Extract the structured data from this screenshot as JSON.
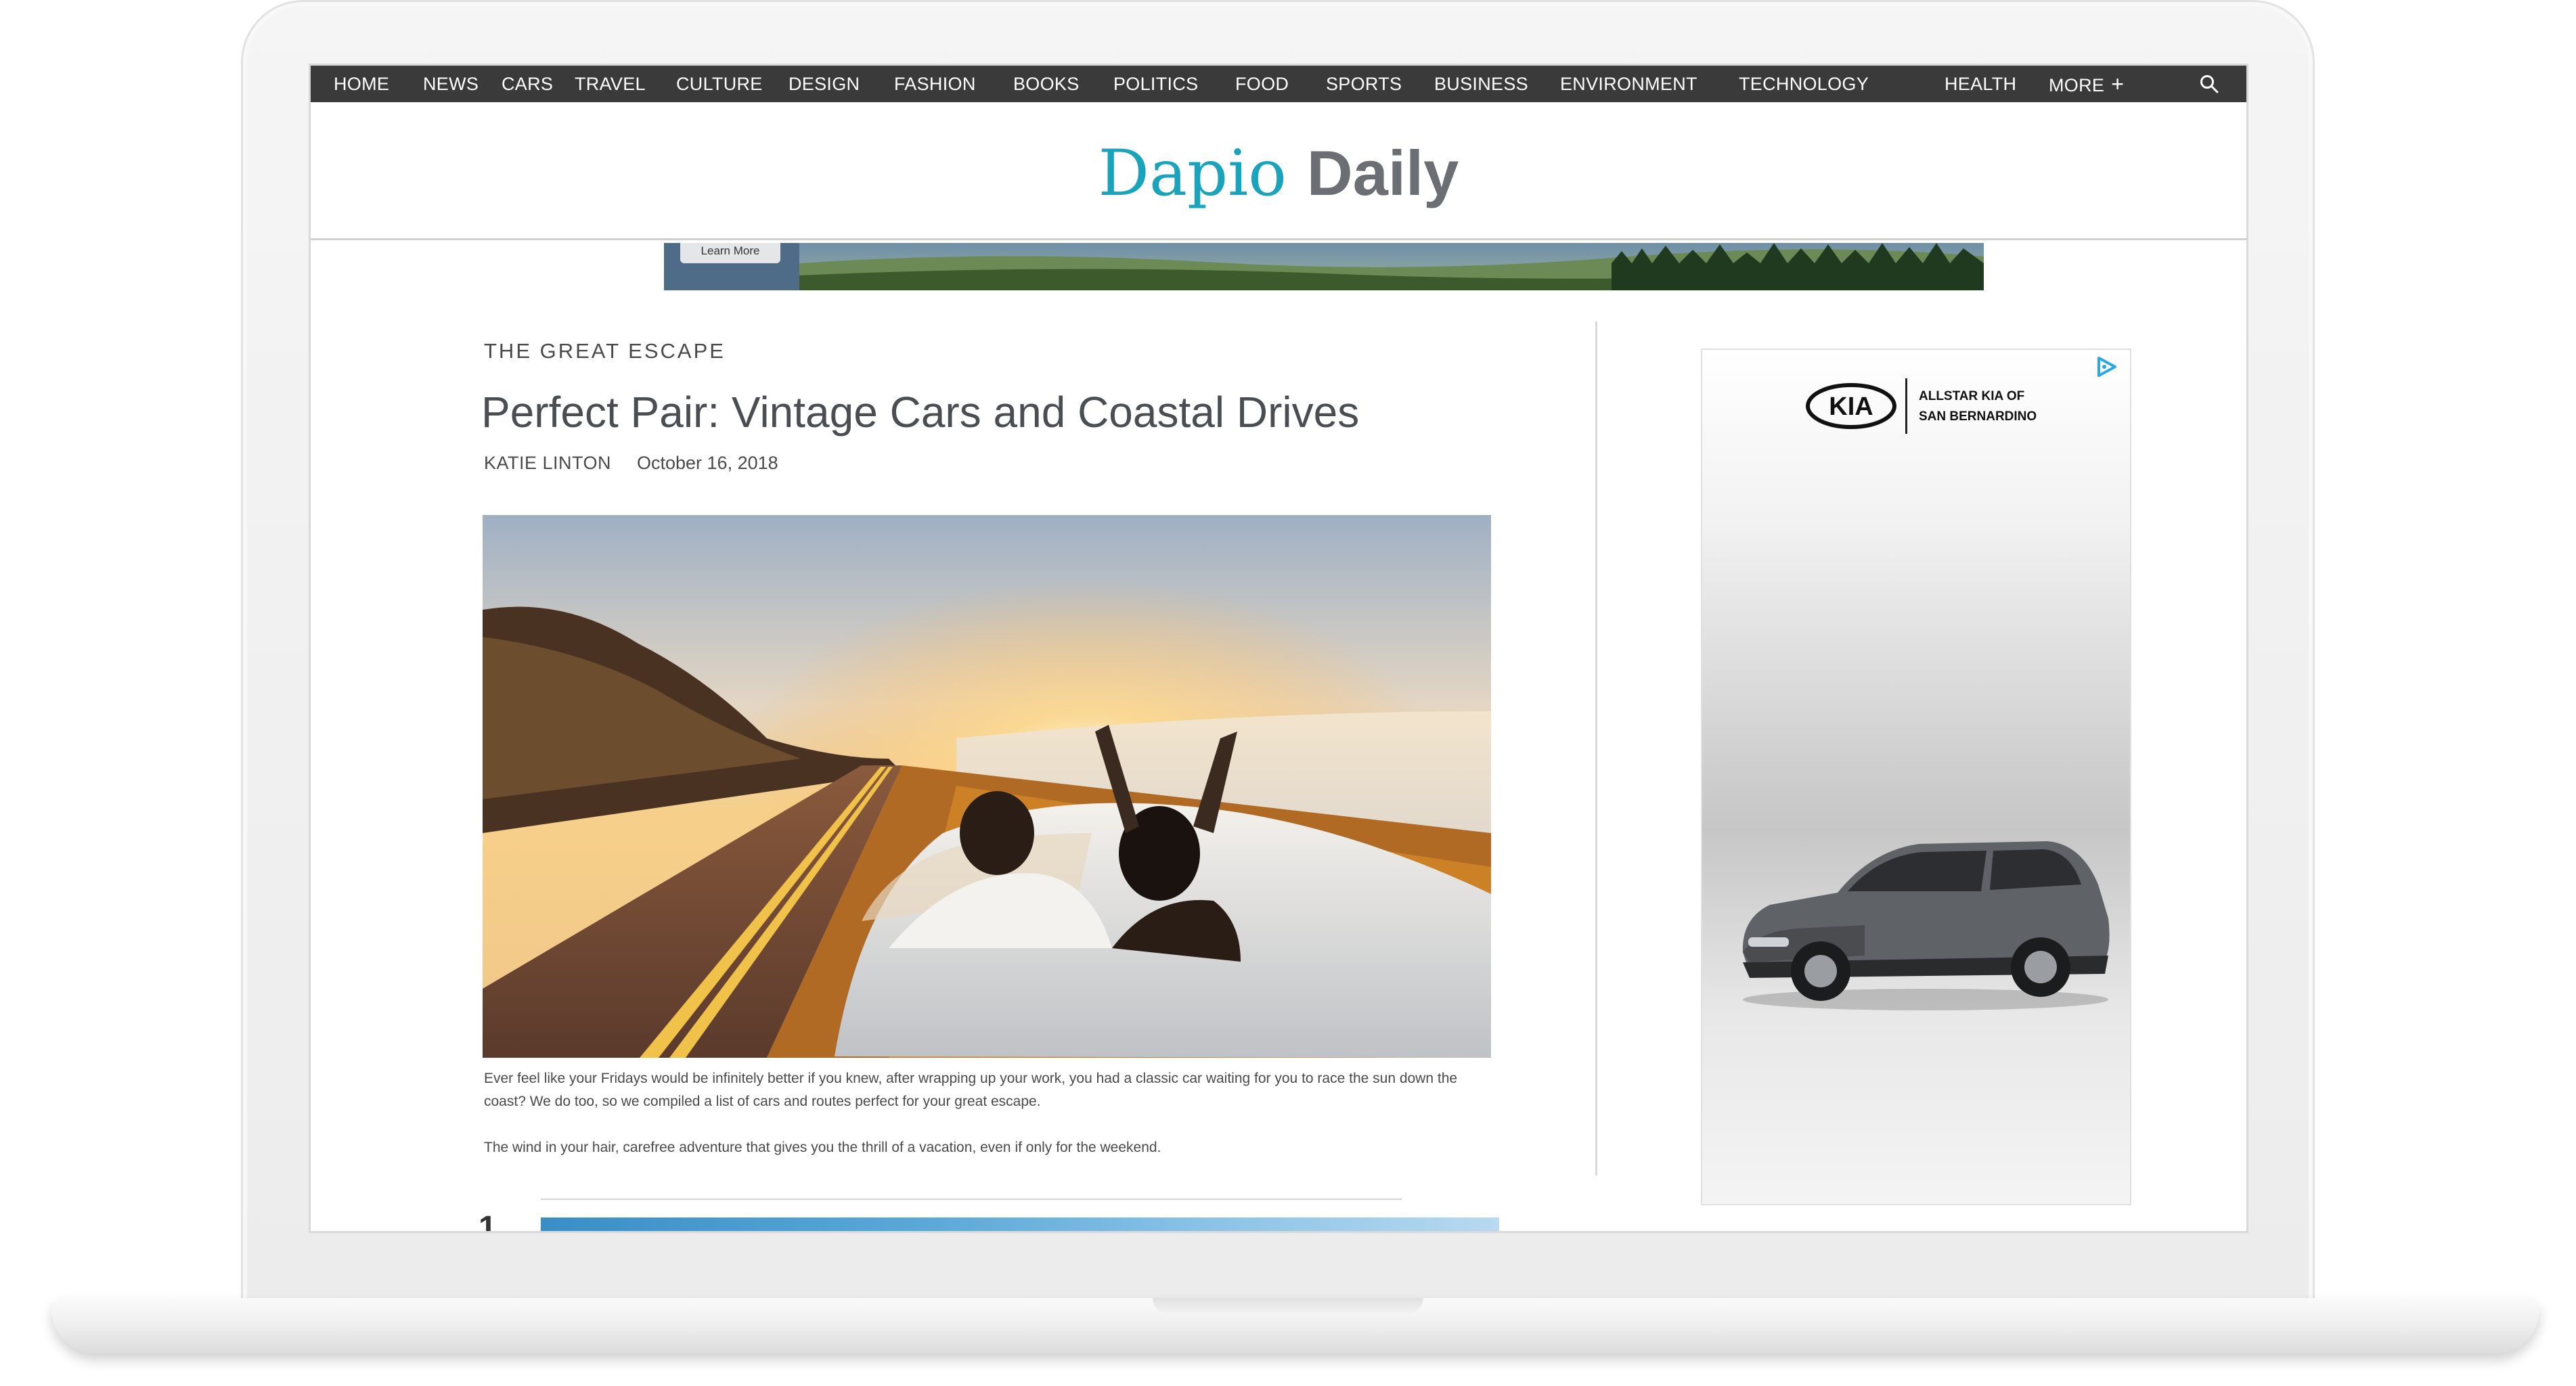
{
  "nav": {
    "items": [
      "HOME",
      "NEWS",
      "CARS",
      "TRAVEL",
      "CULTURE",
      "DESIGN",
      "FASHION",
      "BOOKS",
      "POLITICS",
      "FOOD",
      "SPORTS",
      "BUSINESS",
      "ENVIRONMENT",
      "TECHNOLOGY",
      "HEALTH"
    ],
    "more_label": "MORE",
    "more_icon": "+"
  },
  "site": {
    "name_part1": "Dapio",
    "name_part2": "Daily"
  },
  "banner_ad": {
    "button_label": "Learn More"
  },
  "article": {
    "kicker": "THE GREAT ESCAPE",
    "title": "Perfect Pair: Vintage Cars and Coastal Drives",
    "author": "KATIE LINTON",
    "date": "October 16, 2018",
    "paragraph1": "Ever feel like your Fridays would be infinitely better if you knew, after wrapping up your work, you had a classic car waiting for you to race the sun down the coast? We do too, so we compiled a list of cars and routes perfect for your great escape.",
    "paragraph2": "The wind in your hair, carefree adventure that gives you the thrill of a vacation, even if only for the weekend.",
    "list_number": "1"
  },
  "side_ad": {
    "brand": "KIA",
    "dealer_line1": "ALLSTAR KIA OF",
    "dealer_line2": "SAN BERNARDINO"
  },
  "colors": {
    "nav_bg": "#3a3a3a",
    "logo_accent": "#1aa3bd",
    "logo_secondary": "#6b6e73"
  },
  "icons": [
    "search-icon",
    "plus-icon",
    "adchoices-icon"
  ]
}
